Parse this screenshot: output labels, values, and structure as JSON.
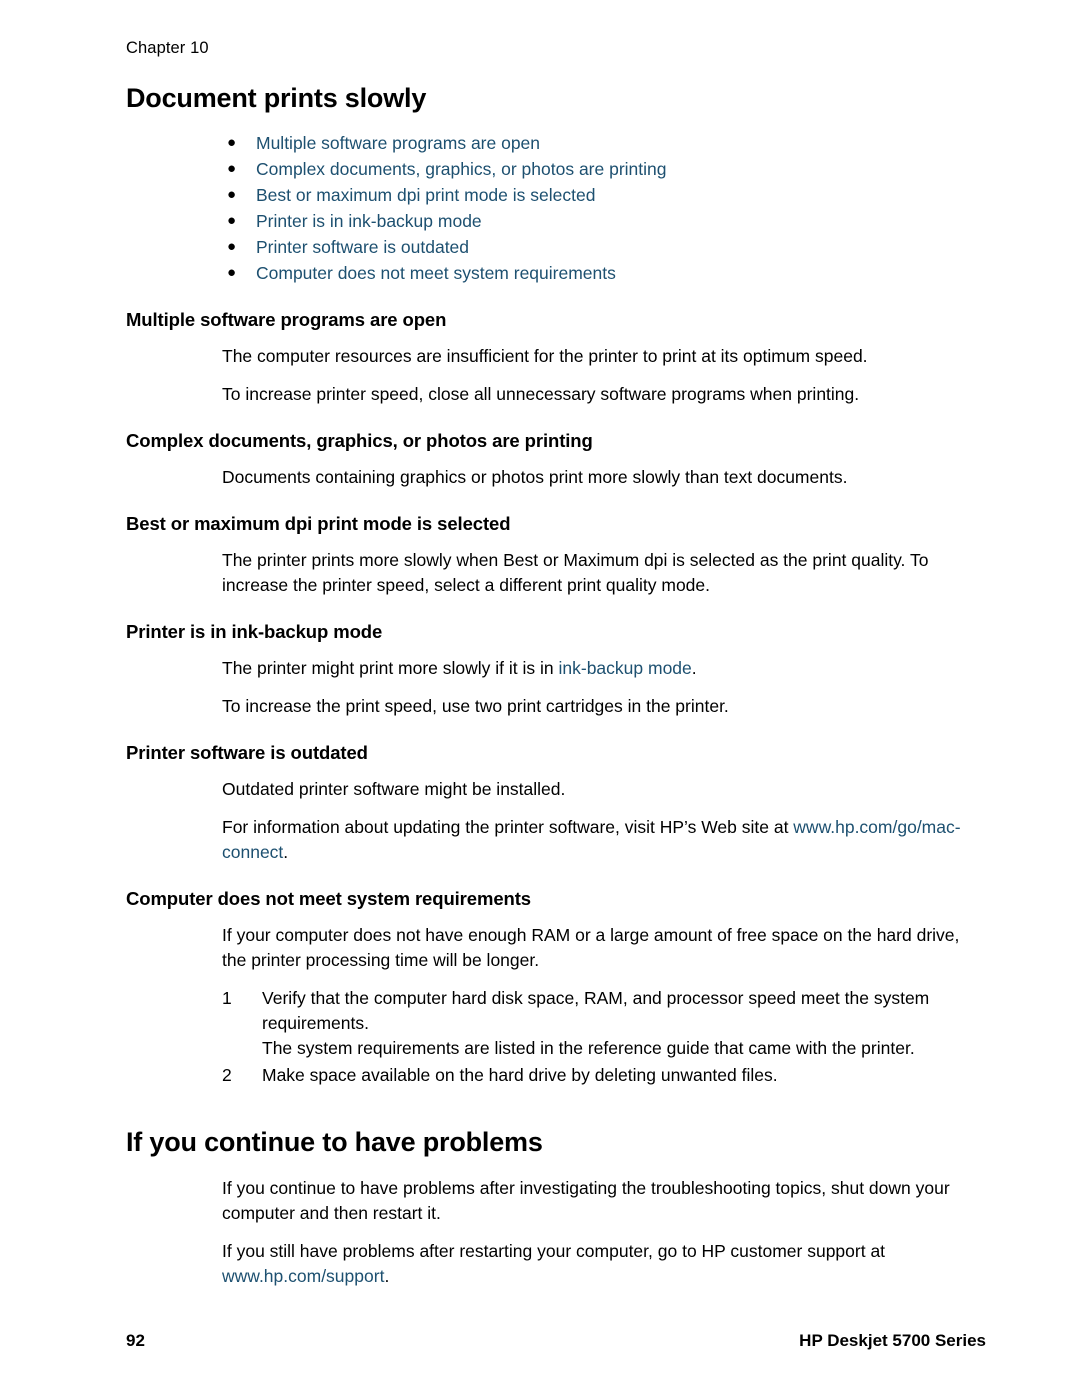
{
  "header": {
    "chapter": "Chapter 10"
  },
  "title": "Document prints slowly",
  "toc_links": [
    {
      "label": "Multiple software programs are open"
    },
    {
      "label": "Complex documents, graphics, or photos are printing"
    },
    {
      "label": "Best or maximum dpi print mode is selected"
    },
    {
      "label": "Printer is in ink-backup mode"
    },
    {
      "label": "Printer software is outdated"
    },
    {
      "label": "Computer does not meet system requirements"
    }
  ],
  "sections": {
    "multiple_programs": {
      "heading": "Multiple software programs are open",
      "p1": "The computer resources are insufficient for the printer to print at its optimum speed.",
      "p2": "To increase printer speed, close all unnecessary software programs when printing."
    },
    "complex_documents": {
      "heading": "Complex documents, graphics, or photos are printing",
      "p1": "Documents containing graphics or photos print more slowly than text documents."
    },
    "best_dpi": {
      "heading": "Best or maximum dpi print mode is selected",
      "p1": "The printer prints more slowly when Best or Maximum dpi is selected as the print quality. To increase the printer speed, select a different print quality mode."
    },
    "ink_backup": {
      "heading": "Printer is in ink-backup mode",
      "p1_before": "The printer might print more slowly if it is in ",
      "p1_link": "ink-backup mode",
      "p1_after": ".",
      "p2": "To increase the print speed, use two print cartridges in the printer."
    },
    "outdated_software": {
      "heading": "Printer software is outdated",
      "p1": "Outdated printer software might be installed.",
      "p2_before": "For information about updating the printer software, visit HP’s Web site at ",
      "p2_link": "www.hp.com/go/mac-connect",
      "p2_after": "."
    },
    "system_requirements": {
      "heading": "Computer does not meet system requirements",
      "p1": "If your computer does not have enough RAM or a large amount of free space on the hard drive, the printer processing time will be longer.",
      "steps": [
        {
          "num": "1",
          "text": "Verify that the computer hard disk space, RAM, and processor speed meet the system requirements.",
          "substep": "The system requirements are listed in the reference guide that came with the printer."
        },
        {
          "num": "2",
          "text": "Make space available on the hard drive by deleting unwanted files.",
          "substep": ""
        }
      ]
    }
  },
  "continue_section": {
    "title": "If you continue to have problems",
    "p1": "If you continue to have problems after investigating the troubleshooting topics, shut down your computer and then restart it.",
    "p2_before": "If you still have problems after restarting your computer, go to HP customer support at ",
    "p2_link": "www.hp.com/support",
    "p2_after": "."
  },
  "footer": {
    "page_number": "92",
    "product": "HP Deskjet 5700 Series"
  },
  "colors": {
    "link": "#1d5070",
    "text": "#000000",
    "background": "#ffffff"
  },
  "icons": {
    "bullet": "bullet-icon"
  }
}
